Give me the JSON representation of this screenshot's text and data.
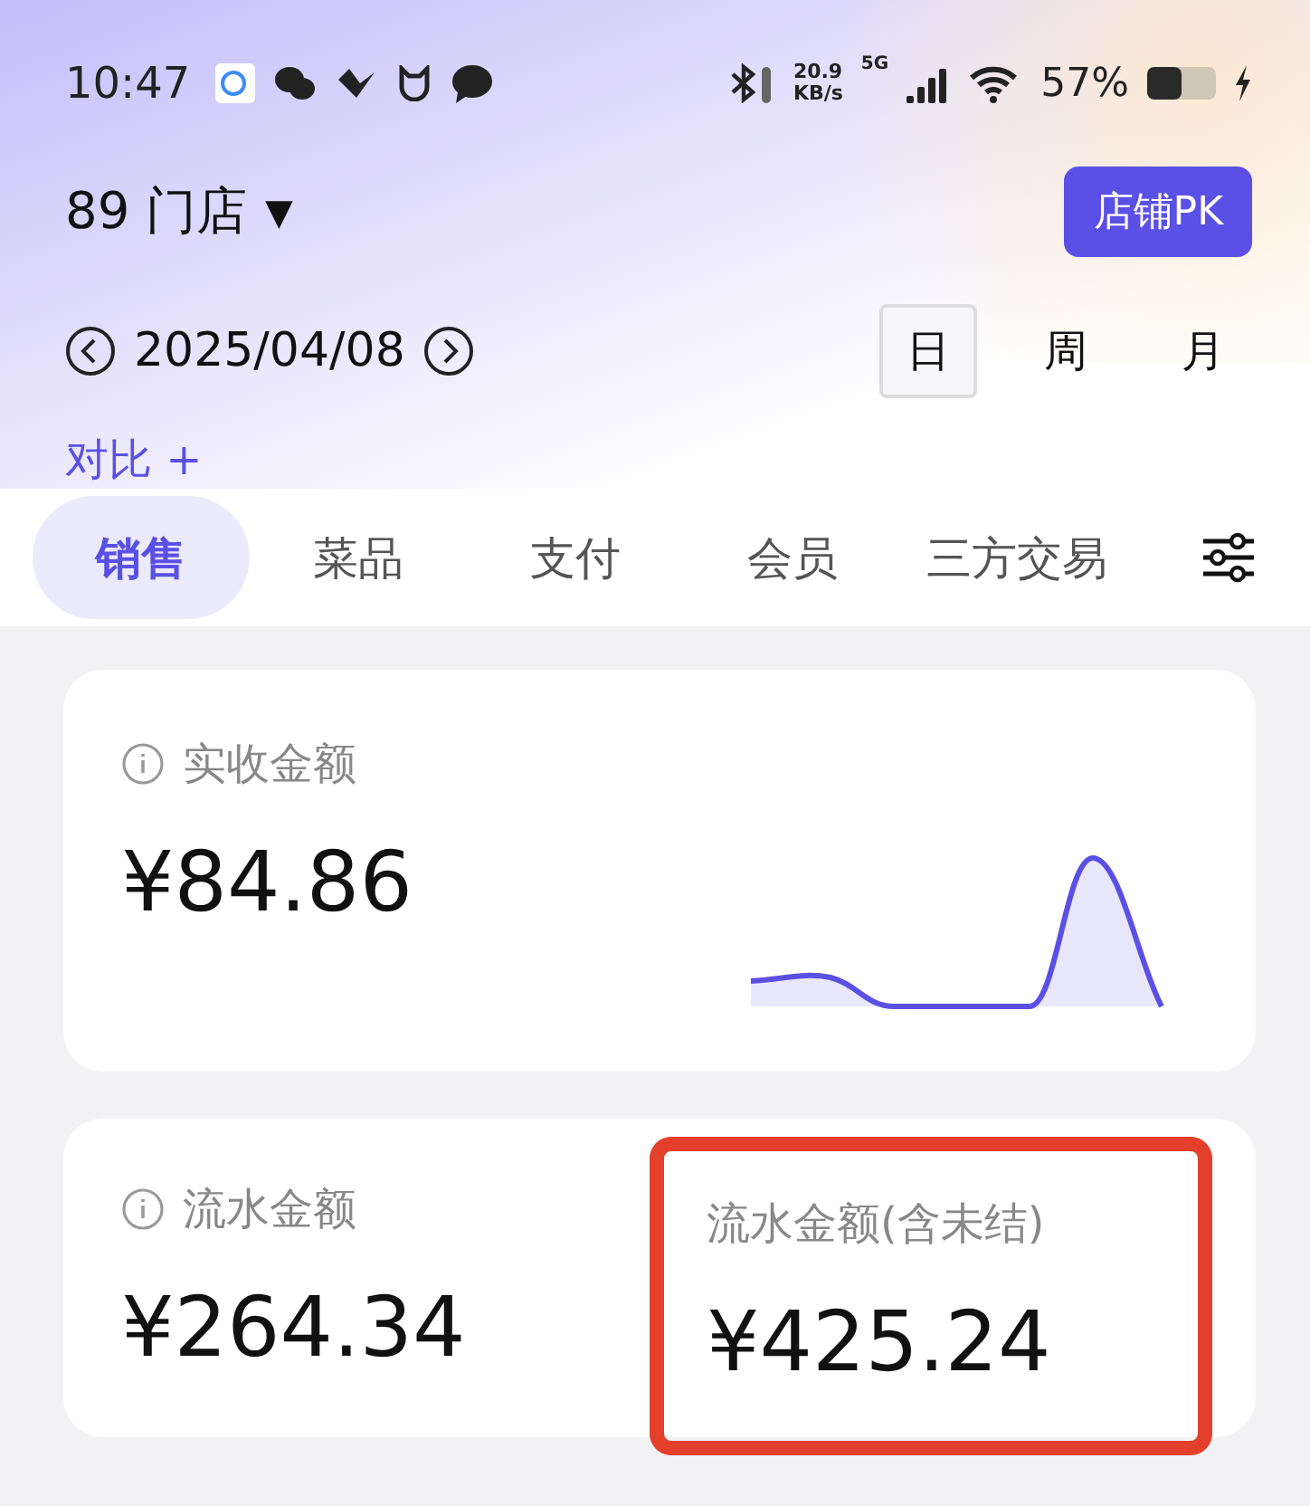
{
  "status_bar": {
    "time": "10:47",
    "speed": "20.9",
    "speed_unit": "KB/s",
    "network": "5G",
    "battery": "57%"
  },
  "store": {
    "name": "89 门店",
    "caret": "▼"
  },
  "pk_button": "店铺PK",
  "date": "2025/04/08",
  "periods": [
    {
      "label": "日",
      "selected": true
    },
    {
      "label": "周",
      "selected": false
    },
    {
      "label": "月",
      "selected": false
    }
  ],
  "compare": "对比 +",
  "tabs": [
    {
      "label": "销售",
      "selected": true
    },
    {
      "label": "菜品",
      "selected": false
    },
    {
      "label": "支付",
      "selected": false
    },
    {
      "label": "会员",
      "selected": false
    },
    {
      "label": "三方交易",
      "selected": false
    }
  ],
  "main_metric": {
    "label": "实收金额",
    "value": "¥84.86",
    "info": true
  },
  "metrics": [
    {
      "label": "流水金额",
      "value": "¥264.34",
      "info": true,
      "highlighted": false
    },
    {
      "label": "流水金额(含未结)",
      "value": "¥425.24",
      "info": false,
      "highlighted": true
    }
  ]
}
